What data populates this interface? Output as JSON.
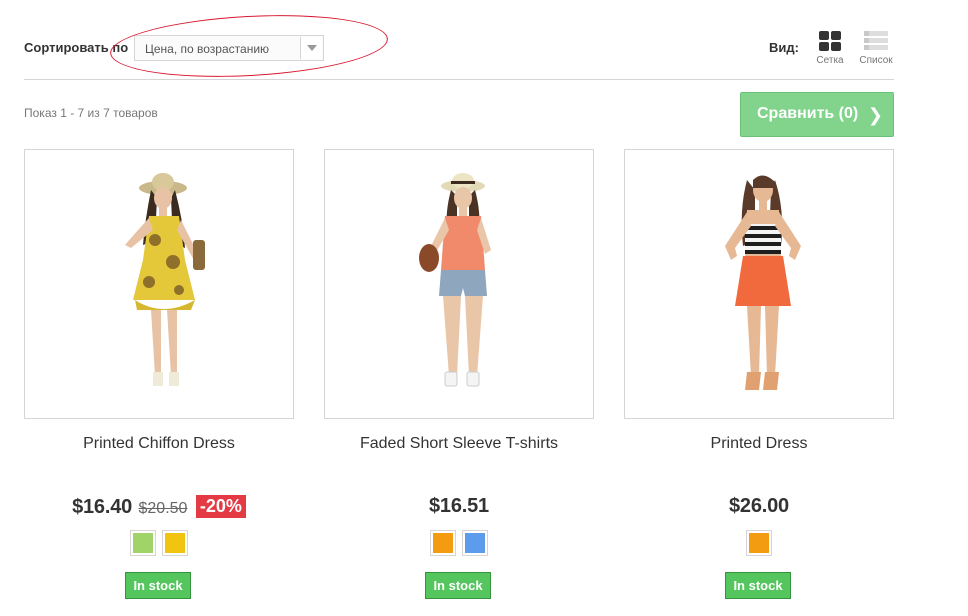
{
  "sort": {
    "label": "Сортировать по",
    "selected": "Цена, по возрастанию"
  },
  "view": {
    "label": "Вид:",
    "grid_label": "Сетка",
    "list_label": "Список"
  },
  "listing": {
    "count_text": "Показ 1 - 7 из 7 товаров",
    "compare_label": "Сравнить (0)"
  },
  "products": [
    {
      "name": "Printed Chiffon Dress",
      "price": "$16.40",
      "old_price": "$20.50",
      "discount": "-20%",
      "colors": [
        "#a0d468",
        "#f1c40f"
      ],
      "stock": "In stock",
      "outfit": "yellow floral dress with straw hat"
    },
    {
      "name": "Faded Short Sleeve T-shirts",
      "price": "$16.51",
      "colors": [
        "#f39c11",
        "#5d9cec"
      ],
      "stock": "In stock",
      "outfit": "coral top with denim shorts and straw hat"
    },
    {
      "name": "Printed Dress",
      "price": "$26.00",
      "colors": [
        "#f39c11"
      ],
      "stock": "In stock",
      "outfit": "striped top with orange skirt"
    }
  ]
}
